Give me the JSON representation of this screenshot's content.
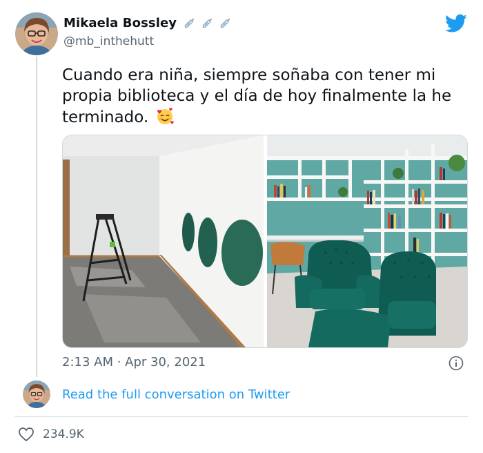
{
  "author": {
    "display_name": "Mikaela Bossley",
    "handle": "@mb_inthehutt",
    "name_emoji": [
      "syringe",
      "syringe",
      "syringe"
    ]
  },
  "tweet": {
    "text": "Cuando era niña, siempre soñaba con tener mi propia biblioteca y el día de hoy finalmente la he terminado.",
    "trailing_emoji": "smiling-face-with-hearts",
    "timestamp": "2:13 AM · Apr 30, 2021",
    "likes": "234.9K"
  },
  "media": {
    "photos": [
      {
        "description": "empty room with green paint swatches and step ladder"
      },
      {
        "description": "finished library with white shelves and green velvet chairs"
      }
    ]
  },
  "footer": {
    "conversation_link": "Read the full conversation on Twitter"
  },
  "colors": {
    "link": "#1d9bf0",
    "secondary_text": "#536471",
    "border": "#cfd9de",
    "twitter_blue": "#1d9bf0"
  }
}
